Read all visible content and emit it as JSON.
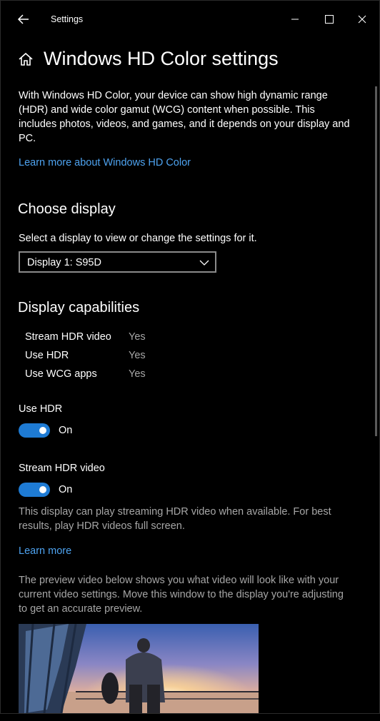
{
  "window": {
    "app_title": "Settings"
  },
  "header": {
    "title": "Windows HD Color settings"
  },
  "intro": {
    "text": "With Windows HD Color, your device can show high dynamic range (HDR) and wide color gamut (WCG) content when possible. This includes photos, videos, and games, and it depends on your display and PC.",
    "learn_more": "Learn more about Windows HD Color"
  },
  "choose_display": {
    "heading": "Choose display",
    "instruction": "Select a display to view or change the settings for it.",
    "selected": "Display 1: S95D"
  },
  "capabilities": {
    "heading": "Display capabilities",
    "rows": [
      {
        "name": "Stream HDR video",
        "value": "Yes"
      },
      {
        "name": "Use HDR",
        "value": "Yes"
      },
      {
        "name": "Use WCG apps",
        "value": "Yes"
      }
    ]
  },
  "use_hdr": {
    "label": "Use HDR",
    "state": "On"
  },
  "stream_hdr": {
    "label": "Stream HDR video",
    "state": "On",
    "description": "This display can play streaming HDR video when available. For best results, play HDR videos full screen.",
    "learn_more": "Learn more"
  },
  "preview": {
    "description": "The preview video below shows you what video will look like with your current video settings. Move this window to the display you're adjusting to get an accurate preview."
  },
  "colors": {
    "accent": "#1e7bd4",
    "link": "#4ea3f0",
    "background": "#000000"
  }
}
